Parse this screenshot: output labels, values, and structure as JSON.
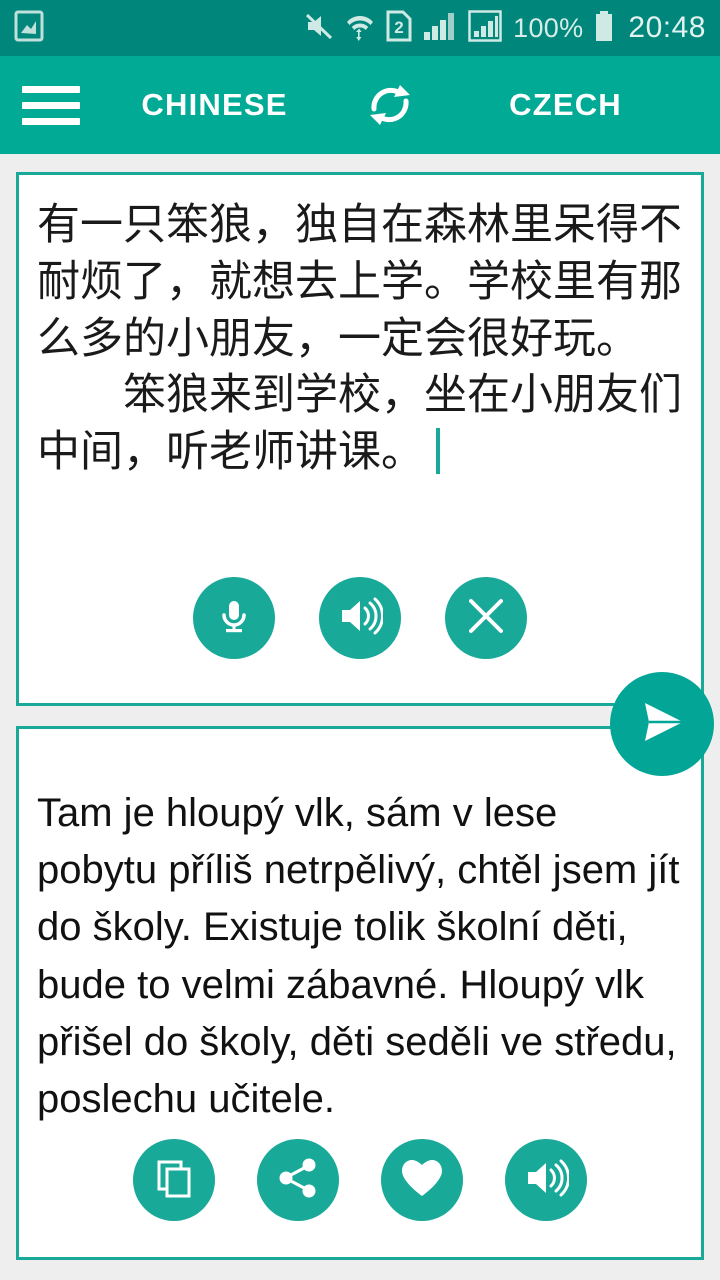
{
  "status_bar": {
    "notification_icon": "image-notification-icon",
    "icons": [
      "mute-icon",
      "wifi-icon",
      "sim2-icon",
      "signal-icon",
      "signal-boxed-icon"
    ],
    "battery_percent": "100%",
    "battery_icon": "battery-full-icon",
    "time": "20:48",
    "background": "#00867a"
  },
  "app_bar": {
    "menu_icon": "hamburger-icon",
    "source_language": "CHINESE",
    "swap_icon": "swap-languages-icon",
    "target_language": "CZECH",
    "background": "#00aa94"
  },
  "source_card": {
    "text": "有一只笨狼，独自在森林里呆得不耐烦了，就想去上学。学校里有那么多的小朋友，一定会很好玩。\n　　笨狼来到学校，坐在小朋友们中间，听老师讲课。",
    "has_caret": true,
    "actions": [
      {
        "name": "microphone-button",
        "icon": "microphone-icon"
      },
      {
        "name": "speak-source-button",
        "icon": "speaker-icon"
      },
      {
        "name": "clear-source-button",
        "icon": "close-icon"
      }
    ]
  },
  "translate_button": {
    "name": "send-translate-button",
    "icon": "send-icon"
  },
  "target_card": {
    "text": "Tam je hloupý vlk, sám v lese pobytu příliš netrpělivý, chtěl jsem jít do školy. Existuje tolik školní děti, bude to velmi zábavné. Hloupý vlk přišel do školy, děti seděli ve středu, poslechu učitele.",
    "actions": [
      {
        "name": "copy-button",
        "icon": "copy-icon"
      },
      {
        "name": "share-button",
        "icon": "share-icon"
      },
      {
        "name": "favorite-button",
        "icon": "heart-icon"
      },
      {
        "name": "speak-target-button",
        "icon": "speaker-icon"
      }
    ]
  },
  "colors": {
    "accent": "#18a999",
    "app_bar": "#00aa94",
    "status_bar": "#00867a",
    "page_background": "#eeeeee"
  }
}
